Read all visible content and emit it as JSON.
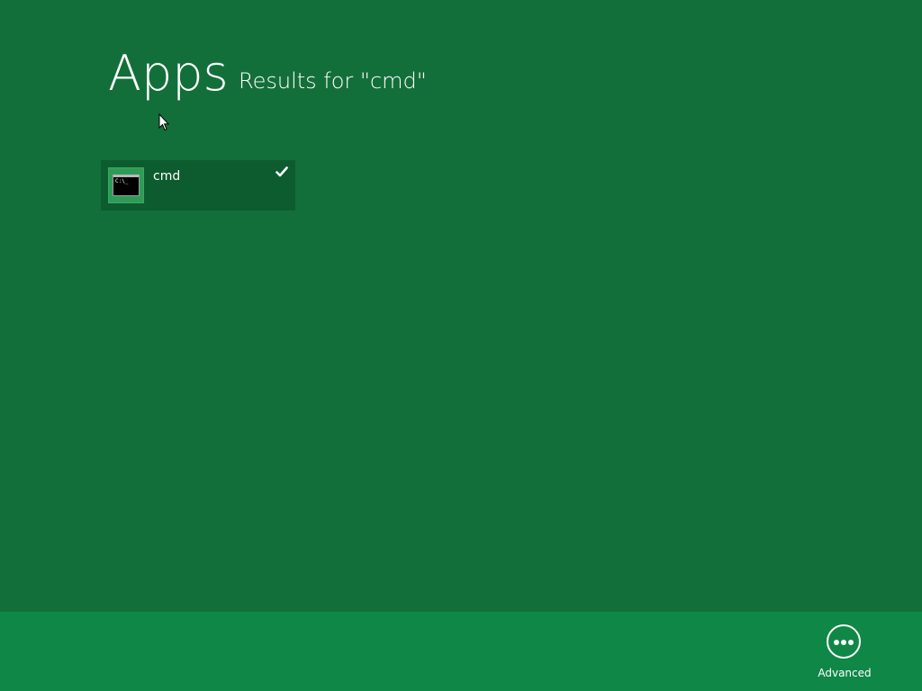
{
  "header": {
    "title": "Apps",
    "subtitle": "Results for \"cmd\""
  },
  "results": [
    {
      "label": "cmd",
      "icon": "command-prompt-icon",
      "icon_text": "C:\\_",
      "selected": true
    }
  ],
  "app_bar": {
    "advanced_label": "Advanced",
    "advanced_icon": "more-ellipsis-icon"
  },
  "colors": {
    "background": "#136f3a",
    "tile": "#0c5c2f",
    "app_bar": "#0f8747",
    "text": "#ffffff"
  }
}
